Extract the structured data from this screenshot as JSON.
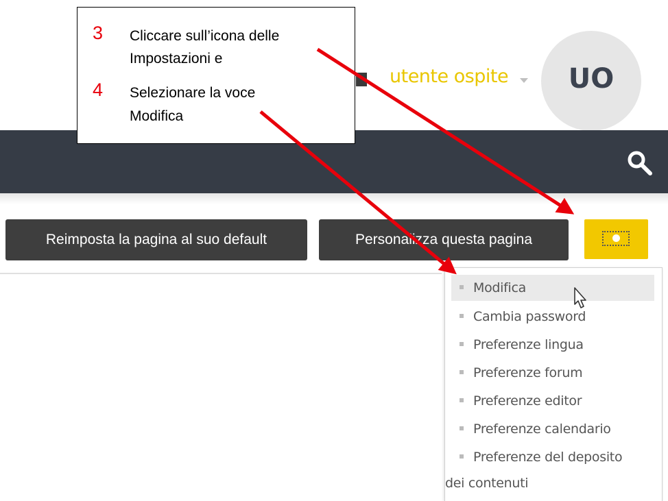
{
  "header": {
    "user_name": "utente ospite",
    "avatar_initials": "UO"
  },
  "page_buttons": {
    "reset_label": "Reimposta la pagina al suo default",
    "customize_label": "Personalizza questa pagina"
  },
  "settings_menu": {
    "items": [
      {
        "label": "Modifica"
      },
      {
        "label": "Cambia password"
      },
      {
        "label": "Preferenze lingua"
      },
      {
        "label": "Preferenze forum"
      },
      {
        "label": "Preferenze editor"
      },
      {
        "label": "Preferenze calendario"
      },
      {
        "label_line1": "Preferenze del deposito",
        "label_line2": "dei contenuti"
      }
    ]
  },
  "callout": {
    "step3_number": "3",
    "step3_line1": "Cliccare sull’icona delle",
    "step3_line2": "Impostazioni e",
    "step4_number": "4",
    "step4_line1": "Selezionare la voce",
    "step4_line2": "Modifica"
  },
  "colors": {
    "navbar": "#363c46",
    "accent_yellow": "#f2c800",
    "user_name": "#e9c600",
    "step_number": "#e8000b",
    "arrow": "#e8000b"
  },
  "icons": [
    "flag-icon",
    "chevron-down-icon",
    "search-icon",
    "gear-icon",
    "mouse-pointer-icon",
    "arrow-icon"
  ]
}
